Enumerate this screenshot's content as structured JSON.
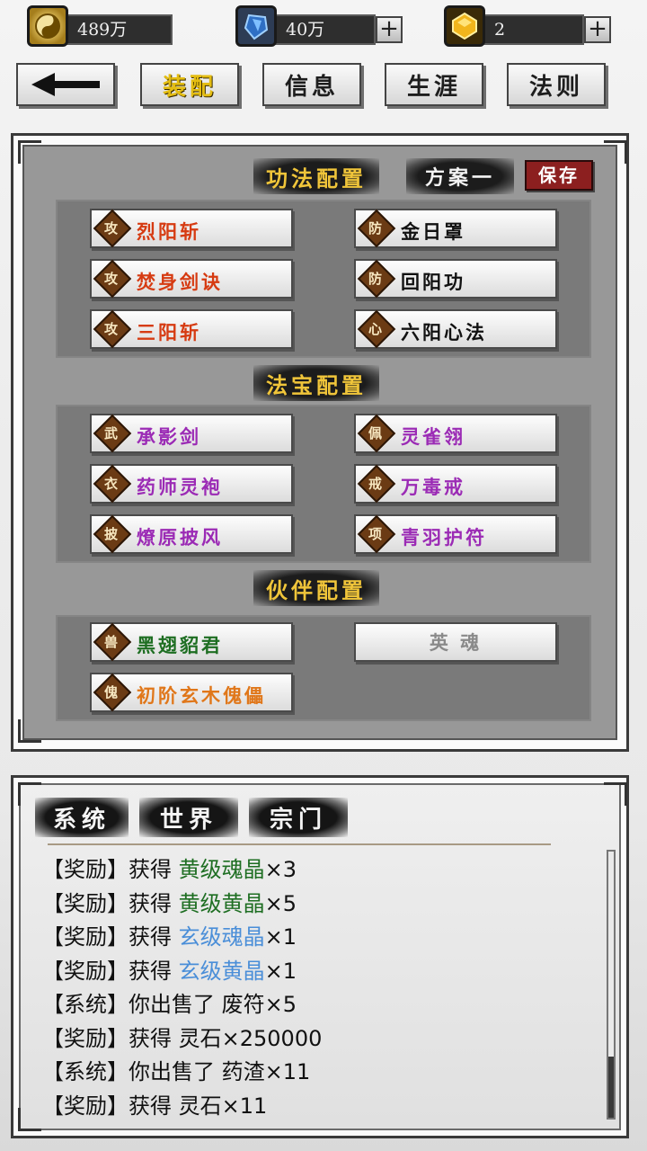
{
  "currency": {
    "spirit_stone": {
      "icon": "yin-yang-coin-icon",
      "value": "489万"
    },
    "gem": {
      "icon": "blue-gem-icon",
      "value": "40万"
    },
    "gold": {
      "icon": "gold-crystal-icon",
      "value": "2"
    }
  },
  "nav": {
    "back_icon": "back-arrow-icon",
    "tabs": [
      "装配",
      "信息",
      "生涯",
      "法则"
    ]
  },
  "skills": {
    "title": "功法配置",
    "plan": "方案一",
    "save_label": "保存",
    "items": [
      {
        "tag": "攻",
        "name": "烈阳斩",
        "color": "#d63b12"
      },
      {
        "tag": "防",
        "name": "金日罩",
        "color": "#111111"
      },
      {
        "tag": "攻",
        "name": "焚身剑诀",
        "color": "#d63b12"
      },
      {
        "tag": "防",
        "name": "回阳功",
        "color": "#111111"
      },
      {
        "tag": "攻",
        "name": "三阳斩",
        "color": "#d63b12"
      },
      {
        "tag": "心",
        "name": "六阳心法",
        "color": "#111111"
      }
    ]
  },
  "treasures": {
    "title": "法宝配置",
    "items": [
      {
        "tag": "武",
        "name": "承影剑",
        "color": "#9b2bb5"
      },
      {
        "tag": "佩",
        "name": "灵雀翎",
        "color": "#9b2bb5"
      },
      {
        "tag": "衣",
        "name": "药师灵袍",
        "color": "#9b2bb5"
      },
      {
        "tag": "戒",
        "name": "万毒戒",
        "color": "#9b2bb5"
      },
      {
        "tag": "披",
        "name": "燎原披风",
        "color": "#9b2bb5"
      },
      {
        "tag": "项",
        "name": "青羽护符",
        "color": "#9b2bb5"
      }
    ]
  },
  "partners": {
    "title": "伙伴配置",
    "items": [
      {
        "tag": "兽",
        "name": "黑翅貂君",
        "color": "#1e6e22"
      },
      {
        "tag": "傀",
        "name": "初阶玄木傀儡",
        "color": "#e0771a"
      }
    ],
    "empty_label": "英 魂"
  },
  "chat": {
    "tabs": [
      "系统",
      "世界",
      "宗门"
    ],
    "messages": [
      {
        "prefix": "【奖励】获得 ",
        "item": "黄级魂晶",
        "suffix": "×3",
        "class": "green"
      },
      {
        "prefix": "【奖励】获得 ",
        "item": "黄级黄晶",
        "suffix": "×5",
        "class": "green"
      },
      {
        "prefix": "【奖励】获得 ",
        "item": "玄级魂晶",
        "suffix": "×1",
        "class": "blue"
      },
      {
        "prefix": "【奖励】获得 ",
        "item": "玄级黄晶",
        "suffix": "×1",
        "class": "blue"
      },
      {
        "prefix": "【系统】你出售了 ",
        "item": "废符",
        "suffix": "×5",
        "class": ""
      },
      {
        "prefix": "【奖励】获得 ",
        "item": "灵石",
        "suffix": "×250000",
        "class": ""
      },
      {
        "prefix": "【系统】你出售了 ",
        "item": "药渣",
        "suffix": "×11",
        "class": ""
      },
      {
        "prefix": "【奖励】获得 ",
        "item": "灵石",
        "suffix": "×11",
        "class": ""
      }
    ]
  }
}
